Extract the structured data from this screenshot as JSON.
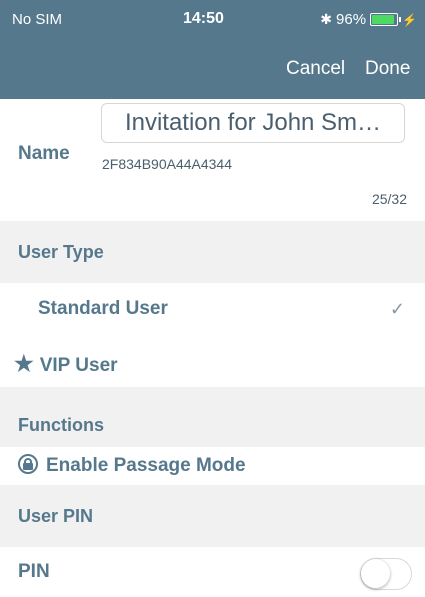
{
  "status_bar": {
    "carrier": "No SIM",
    "time": "14:50",
    "battery": "96%",
    "battery_color": "#4cd964"
  },
  "nav": {
    "cancel_label": "Cancel",
    "done_label": "Done"
  },
  "name_field": {
    "label": "Name",
    "value": "Invitation for John Sm…",
    "code": "2F834B90A44A4344",
    "counter": "25/32"
  },
  "user_type": {
    "header": "User Type",
    "options": [
      {
        "label": "Standard User",
        "selected": true
      },
      {
        "label": "VIP User",
        "icon": "star-icon",
        "selected": false
      }
    ]
  },
  "functions": {
    "header": "Functions",
    "items": [
      {
        "label": "Enable Passage Mode",
        "icon": "lock-icon"
      }
    ]
  },
  "user_pin": {
    "header": "User PIN",
    "pin_label": "PIN",
    "enabled": false
  },
  "colors": {
    "accent": "#56788d",
    "section_bg": "#f1f1f1"
  }
}
